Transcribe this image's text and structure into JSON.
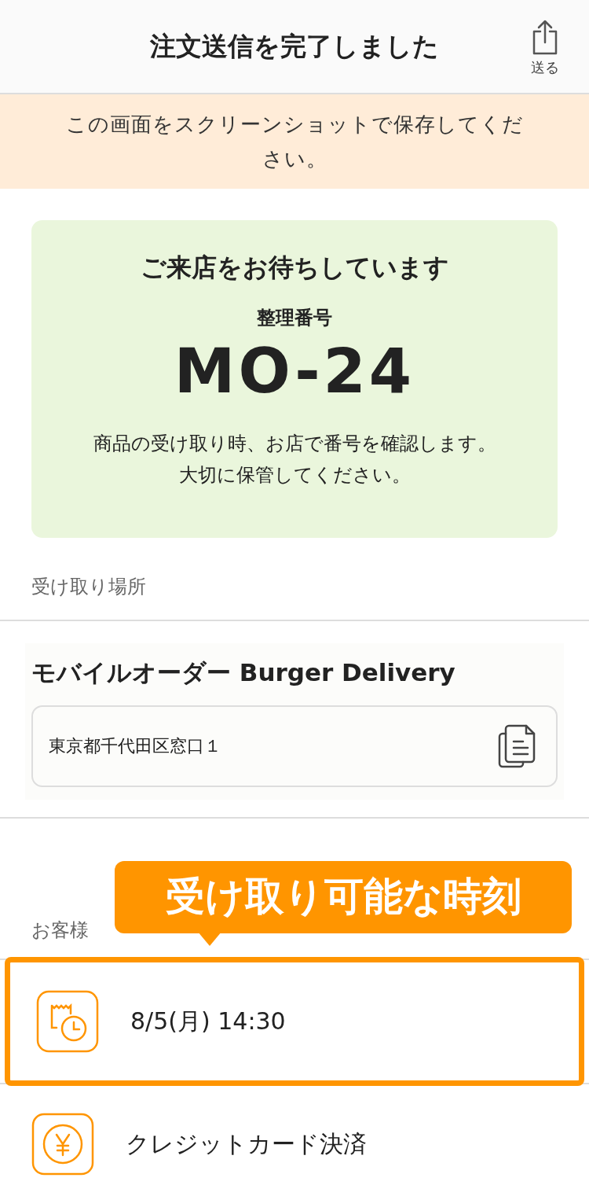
{
  "header": {
    "title": "注文送信を完了しました",
    "share_label": "送る"
  },
  "notice": "この画面をスクリーンショットで保存してください。",
  "ticket": {
    "heading": "ご来店をお待ちしています",
    "number_label": "整理番号",
    "number": "MO-24",
    "note": [
      "商品の受け取り時、お店で番号を確認します。",
      "大切に保管してください。"
    ]
  },
  "pickup": {
    "section_label": "受け取り場所",
    "store_name": "モバイルオーダー Burger Delivery",
    "address": "東京都千代田区窓口１"
  },
  "customer": {
    "section_label": "お客様",
    "callout": "受け取り可能な時刻",
    "rows": [
      {
        "kind": "time",
        "text": "8/5(月) 14:30",
        "highlighted": true
      },
      {
        "kind": "payment",
        "text": "クレジットカード決済",
        "highlighted": false
      }
    ]
  }
}
